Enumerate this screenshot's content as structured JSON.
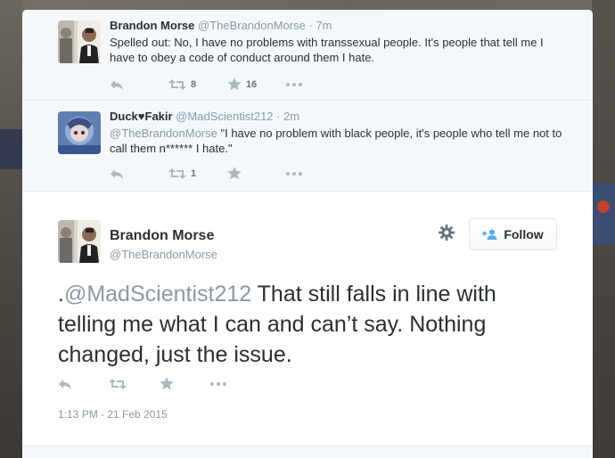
{
  "replies": [
    {
      "name": "Brandon Morse",
      "handle_time": "@TheBrandonMorse · 7m",
      "text_mention": "",
      "text": "Spelled out: No, I have no problems with transsexual people. It's people that tell me I have to obey a code of conduct around them I hate.",
      "retweets": "8",
      "favorites": "16",
      "avatar_icon": "person-photo-icon"
    },
    {
      "name": "Duck♥Fakir",
      "handle_time": "@MadScientist212 · 2m",
      "text_mention": "@TheBrandonMorse",
      "text": " \"I have no problem with black people, it's people who tell me not to call them n****** I hate.\"",
      "retweets": "1",
      "favorites": "",
      "avatar_icon": "anime-avatar-icon"
    }
  ],
  "main": {
    "name": "Brandon Morse",
    "handle": "@TheBrandonMorse",
    "text_prefix": ".",
    "text_mention": "@MadScientist212",
    "text": " That still falls in line with telling me what I can and can’t say. Nothing changed, just the issue.",
    "follow_label": "Follow",
    "timestamp": "1:13 PM - 21 Feb 2015"
  },
  "colors": {
    "text": "#292f33",
    "muted": "#8899a6",
    "follow_icon": "#55acee",
    "reply_bg": "#f5f8fa"
  }
}
